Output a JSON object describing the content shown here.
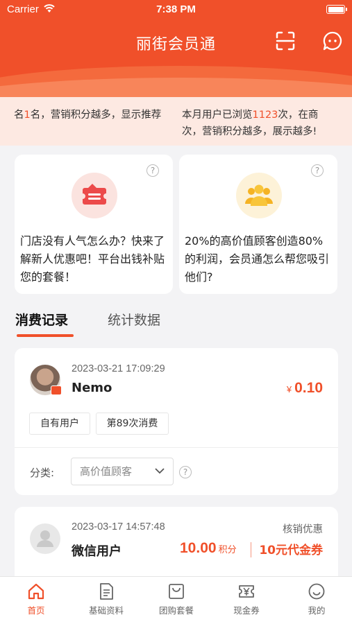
{
  "status_bar": {
    "carrier": "Carrier",
    "time": "7:38 PM"
  },
  "header": {
    "title": "丽街会员通"
  },
  "marquee": {
    "left_before": "名",
    "left_highlight": "1",
    "left_after": "名，营销积分越多，显示推荐",
    "right_line1_before": "本月用户已浏览",
    "right_line1_highlight": "1123",
    "right_line1_after": "次，在商",
    "right_line2": "次，营销积分越多，展示越多!"
  },
  "promos": [
    {
      "text": "门店没有人气怎么办？快来了解新人优惠吧！平台出钱补贴您的套餐！",
      "icon": "ticket-icon"
    },
    {
      "text": "20%的高价值顾客创造80%的利润，会员通怎么帮您吸引他们?",
      "icon": "group-icon"
    }
  ],
  "tabs": {
    "records": "消费记录",
    "stats": "统计数据"
  },
  "record1": {
    "datetime": "2023-03-21 17:09:29",
    "name": "Nemo",
    "currency": "¥",
    "amount": "0.10",
    "tags": [
      "自有用户",
      "第89次消费"
    ],
    "category_label": "分类:",
    "category_value": "高价值顾客"
  },
  "record2": {
    "datetime": "2023-03-17 14:57:48",
    "name": "微信用户",
    "coupon_label": "核销优惠",
    "points": "10.00",
    "points_unit": "积分",
    "voucher": "10元代金券"
  },
  "nav": [
    {
      "label": "首页",
      "icon": "home-icon",
      "active": true
    },
    {
      "label": "基础资料",
      "icon": "document-icon",
      "active": false
    },
    {
      "label": "团购套餐",
      "icon": "bag-icon",
      "active": false
    },
    {
      "label": "现金券",
      "icon": "yen-ticket-icon",
      "active": false
    },
    {
      "label": "我的",
      "icon": "smile-icon",
      "active": false
    }
  ],
  "colors": {
    "accent": "#f0502a",
    "marquee_bg": "#fde9e2",
    "page_bg": "#f3f3f5"
  }
}
